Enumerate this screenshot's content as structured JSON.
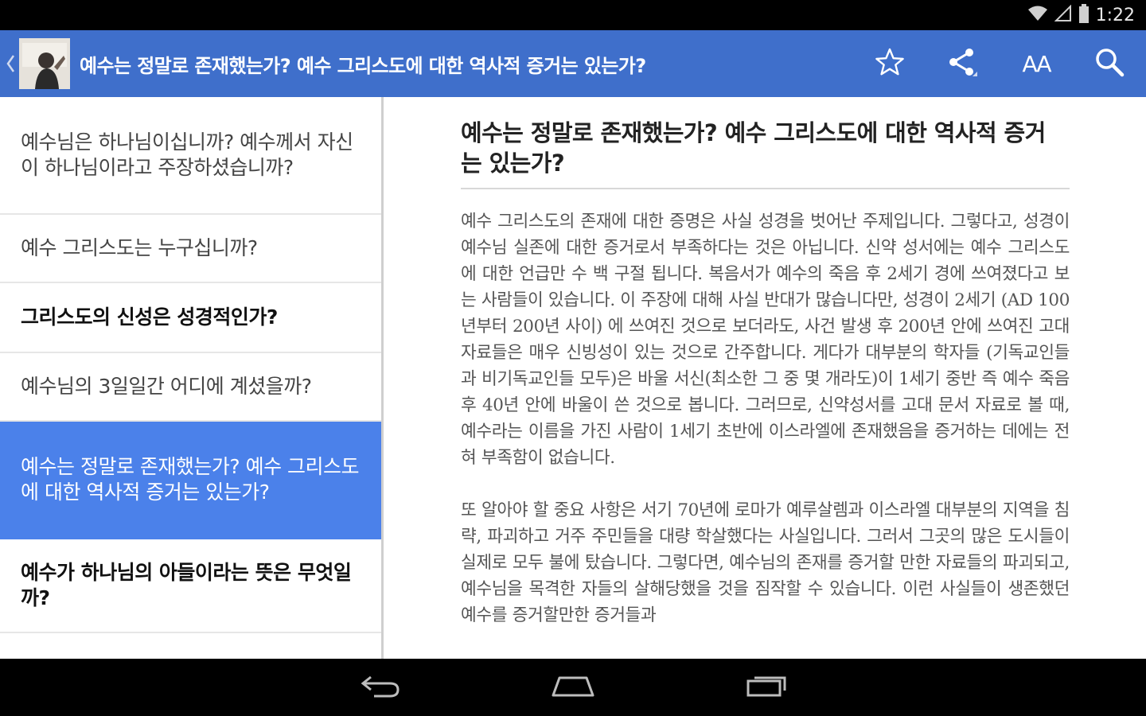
{
  "status_bar": {
    "time": "1:22",
    "icons": [
      "wifi-icon",
      "signal-icon",
      "battery-icon"
    ]
  },
  "action_bar": {
    "title": "예수는 정말로 존재했는가? 예수 그리스도에 대한 역사적 증거는 있는가?",
    "actions": [
      "star-icon",
      "share-icon",
      "text-size-icon",
      "search-icon"
    ],
    "text_size_label": "AA"
  },
  "article_list": [
    {
      "title": "예수님은 하나님이십니까? 예수께서 자신이 하나님이라고 주장하셨습니까?",
      "bold": false,
      "selected": false
    },
    {
      "title": "예수 그리스도는 누구십니까?",
      "bold": false,
      "selected": false
    },
    {
      "title": "그리스도의 신성은 성경적인가?",
      "bold": true,
      "selected": false
    },
    {
      "title": "예수님의 3일일간 어디에 계셨을까?",
      "bold": false,
      "selected": false
    },
    {
      "title": "예수는 정말로 존재했는가? 예수 그리스도에 대한 역사적 증거는 있는가?",
      "bold": false,
      "selected": true
    },
    {
      "title": "예수가 하나님의 아들이라는 뜻은 무엇일까?",
      "bold": true,
      "selected": false
    }
  ],
  "article": {
    "title": "예수는 정말로 존재했는가? 예수 그리스도에 대한 역사적 증거는 있는가?",
    "paragraphs": [
      "예수 그리스도의 존재에 대한 증명은 사실 성경을 벗어난 주제입니다. 그렇다고, 성경이 예수님 실존에 대한 증거로서 부족하다는 것은 아닙니다. 신약 성서에는 예수 그리스도에 대한 언급만 수 백 구절 됩니다. 복음서가 예수의 죽음 후 2세기 경에 쓰여졌다고 보는 사람들이 있습니다. 이 주장에 대해 사실 반대가 많습니다만, 성경이 2세기 (AD 100년부터 200년 사이) 에 쓰여진 것으로 보더라도, 사건 발생 후 200년 안에 쓰여진 고대 자료들은 매우 신빙성이 있는 것으로 간주합니다. 게다가 대부분의 학자들 (기독교인들과 비기독교인들 모두)은 바울 서신(최소한 그 중 몇 개라도)이 1세기 중반 즉 예수 죽음 후 40년 안에 바울이 쓴 것으로 봅니다. 그러므로, 신약성서를 고대 문서 자료로 볼 때, 예수라는 이름을 가진 사람이 1세기 초반에 이스라엘에 존재했음을 증거하는 데에는 전혀 부족함이 없습니다.",
      "또 알아야 할 중요 사항은 서기 70년에 로마가 예루살렘과 이스라엘 대부분의 지역을 침략, 파괴하고 거주 주민들을 대량 학살했다는 사실입니다. 그러서 그곳의 많은 도시들이 실제로 모두 불에 탔습니다. 그렇다면, 예수님의 존재를 증거할 만한 자료들의 파괴되고, 예수님을 목격한 자들의 살해당했을 것을 짐작할 수 있습니다. 이런 사실들이 생존했던 예수를 증거할만한 증거들과"
    ]
  },
  "nav_bar": {
    "buttons": [
      "back-icon",
      "home-icon",
      "recents-icon"
    ]
  },
  "colors": {
    "action_bar": "#3f6fcb",
    "selected_item": "#4b81ea",
    "background": "#ffffff"
  }
}
